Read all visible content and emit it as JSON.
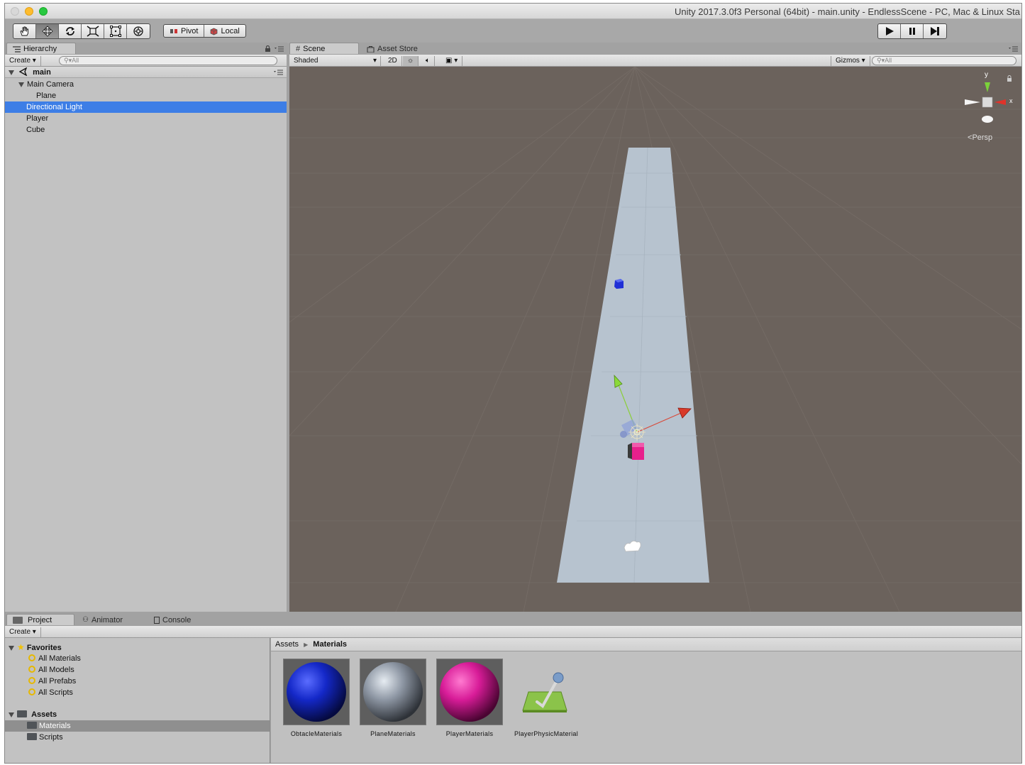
{
  "window": {
    "title": "Unity 2017.3.0f3 Personal (64bit) - main.unity - EndlessScene - PC, Mac & Linux Sta"
  },
  "toolbar": {
    "tools": [
      "hand-tool-icon",
      "move-tool-icon",
      "rotate-tool-icon",
      "scale-tool-icon",
      "rect-tool-icon",
      "transform-tool-icon"
    ],
    "active_tool": "move",
    "pivot_label": "Pivot",
    "local_label": "Local",
    "play_controls": [
      "play-icon",
      "pause-icon",
      "step-icon"
    ]
  },
  "hierarchy": {
    "tab_label": "Hierarchy",
    "create_label": "Create",
    "search_placeholder": "All",
    "scene_name": "main",
    "items": [
      {
        "label": "Main Camera",
        "depth": 0,
        "expanded": true,
        "selected": false
      },
      {
        "label": "Plane",
        "depth": 1,
        "expanded": false,
        "selected": false
      },
      {
        "label": "Directional Light",
        "depth": 0,
        "expanded": false,
        "selected": true
      },
      {
        "label": "Player",
        "depth": 0,
        "expanded": false,
        "selected": false
      },
      {
        "label": "Cube",
        "depth": 0,
        "expanded": false,
        "selected": false
      }
    ]
  },
  "scene": {
    "tab_scene": "Scene",
    "tab_asset_store": "Asset Store",
    "shading_mode": "Shaded",
    "mode_2d": "2D",
    "gizmos_label": "Gizmos",
    "search_placeholder": "All",
    "gizmo_y": "y",
    "gizmo_x": "x",
    "projection": "Persp",
    "colors": {
      "background": "#6b625c",
      "plane": "#b7c3cf",
      "obstacle": "#1f2fd6",
      "player": "#e8208c"
    }
  },
  "project": {
    "tab_project": "Project",
    "tab_animator": "Animator",
    "tab_console": "Console",
    "create_label": "Create",
    "favorites_label": "Favorites",
    "favorites": [
      "All Materials",
      "All Models",
      "All Prefabs",
      "All Scripts"
    ],
    "assets_label": "Assets",
    "asset_folders": [
      {
        "label": "Materials",
        "selected": true
      },
      {
        "label": "Scripts",
        "selected": false
      }
    ],
    "breadcrumb": [
      "Assets",
      "Materials"
    ],
    "items": [
      {
        "label": "ObtacleMaterials",
        "kind": "material",
        "color": "#1428c8"
      },
      {
        "label": "PlaneMaterials",
        "kind": "material",
        "color": "#a8b0bc"
      },
      {
        "label": "PlayerMaterials",
        "kind": "material",
        "color": "#d81c98"
      },
      {
        "label": "PlayerPhysicMaterial",
        "kind": "physic-material",
        "color": "#8bc34a"
      }
    ]
  }
}
